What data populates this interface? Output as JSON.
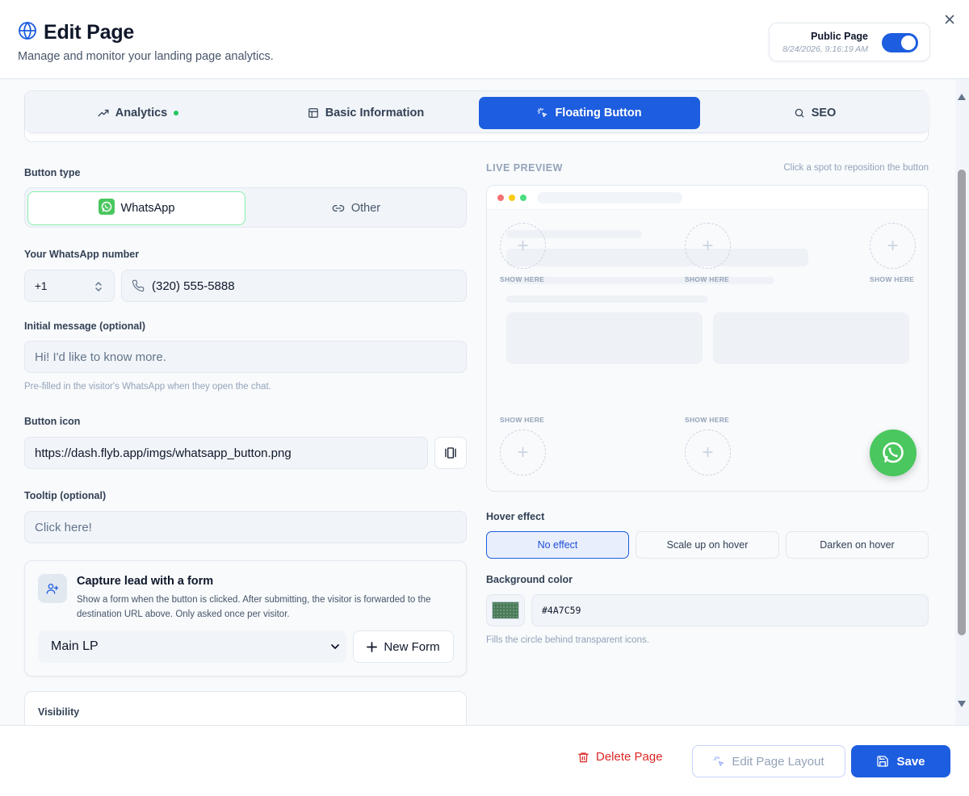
{
  "header": {
    "title": "Edit Page",
    "subtitle": "Manage and monitor your landing page analytics.",
    "public_label": "Public Page",
    "public_timestamp": "8/24/2026, 9:16:19 AM",
    "public_enabled": true
  },
  "tabs": [
    {
      "label": "Analytics",
      "icon": "trend-up-icon",
      "active": false
    },
    {
      "label": "Basic Information",
      "icon": "layout-icon",
      "active": false
    },
    {
      "label": "Floating Button",
      "icon": "sparkle-click-icon",
      "active": true
    },
    {
      "label": "SEO",
      "icon": "search-icon",
      "active": false
    }
  ],
  "form": {
    "button_type_label": "Button type",
    "button_types": [
      {
        "label": "WhatsApp",
        "icon": "whatsapp-icon",
        "active": true
      },
      {
        "label": "Other",
        "icon": "link-icon",
        "active": false
      }
    ],
    "whatsapp_label": "Your WhatsApp number",
    "country_code": "+1",
    "phone": "(320) 555-5888",
    "initial_message_label": "Initial message (optional)",
    "initial_message_placeholder": "Hi! I'd like to know more.",
    "initial_message_hint": "Pre-filled in the visitor's WhatsApp when they open the chat.",
    "button_icon_label": "Button icon",
    "button_icon_url": "https://dash.flyb.app/imgs/whatsapp_button.png",
    "tooltip_label": "Tooltip (optional)",
    "tooltip_placeholder": "Click here!",
    "lead": {
      "title": "Capture lead with a form",
      "description": "Show a form when the button is clicked. After submitting, the visitor is forwarded to the destination URL above. Only asked once per visitor.",
      "selected_form": "Main LP",
      "new_form_label": "New Form"
    },
    "visibility_label": "Visibility"
  },
  "preview": {
    "title": "LIVE PREVIEW",
    "hint": "Click a spot to reposition the button",
    "spot_label": "SHOW HERE",
    "plus": "+"
  },
  "hover": {
    "label": "Hover effect",
    "options": [
      {
        "label": "No effect",
        "active": true
      },
      {
        "label": "Scale up on hover",
        "active": false
      },
      {
        "label": "Darken on hover",
        "active": false
      }
    ]
  },
  "background": {
    "label": "Background color",
    "hex": "#4A7C59",
    "hint": "Fills the circle behind transparent icons."
  },
  "footer": {
    "delete_label": "Delete Page",
    "edit_layout_label": "Edit Page Layout",
    "save_label": "Save"
  },
  "colors": {
    "primary": "#1d5ddf",
    "whatsapp": "#4ac75e",
    "danger": "#dc2626",
    "bg_color": "#4A7C59"
  }
}
